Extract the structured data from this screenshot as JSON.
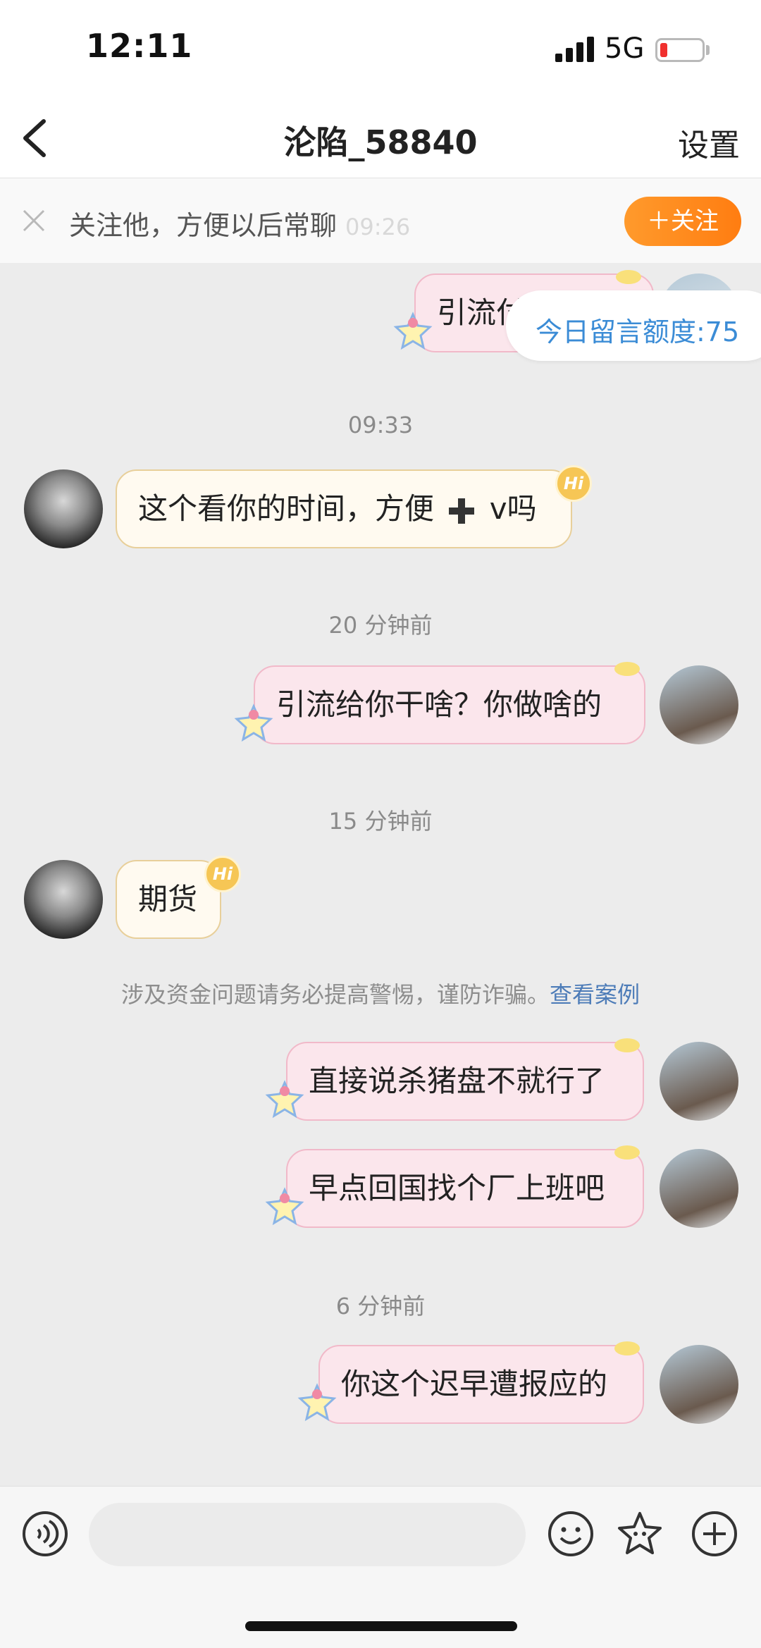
{
  "status": {
    "time": "12:11",
    "network": "5G"
  },
  "nav": {
    "title": "沦陷_58840",
    "settings_label": "设置"
  },
  "follow": {
    "prompt": "关注他，方便以后常聊",
    "button_label": "＋关注",
    "overlap_time": "09:26"
  },
  "quota": {
    "label": "今日留言额度:75"
  },
  "chat": {
    "timestamps": [
      "09:33",
      "20 分钟前",
      "15 分钟前",
      "6 分钟前"
    ],
    "messages": [
      {
        "side": "out",
        "text": "引流付"
      },
      {
        "side": "in",
        "text": "这个看你的时间，方便",
        "suffix": "v吗"
      },
      {
        "side": "out",
        "text": "引流给你干啥？你做啥的"
      },
      {
        "side": "in",
        "text": "期货"
      },
      {
        "side": "out",
        "text": "直接说杀猪盘不就行了"
      },
      {
        "side": "out",
        "text": "早点回国找个厂上班吧"
      },
      {
        "side": "out",
        "text": "你这个迟早遭报应的"
      }
    ],
    "badge": "Hi",
    "warning": {
      "text": "涉及资金问题请务必提高警惕，谨防诈骗。",
      "link": "查看案例"
    }
  },
  "colors": {
    "accent_orange": "#ff8a1f",
    "link_blue": "#3b8cd6",
    "in_bubble": "#fffaf0",
    "out_bubble": "#fbe6ec"
  },
  "icons": [
    "back-chevron-icon",
    "close-icon",
    "voice-icon",
    "emoji-icon",
    "sticker-star-icon",
    "add-icon"
  ]
}
